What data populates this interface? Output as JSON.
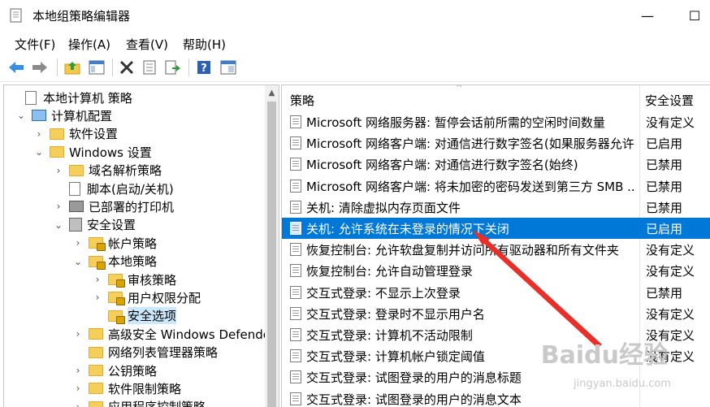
{
  "window": {
    "title": "本地组策略编辑器",
    "minimize": "—",
    "maximize": "☐"
  },
  "menu": [
    "文件(F)",
    "操作(A)",
    "查看(V)",
    "帮助(H)"
  ],
  "toolbar_icons": [
    "back-icon",
    "forward-icon",
    "up-folder-icon",
    "show-hide-tree-icon",
    "delete-icon",
    "properties-icon",
    "export-icon",
    "help-icon",
    "filter-icon"
  ],
  "tree": [
    {
      "label": "本地计算机 策略",
      "expand": "",
      "icon": "doc"
    },
    {
      "label": "计算机配置",
      "expand": "v",
      "icon": "pc"
    },
    {
      "label": "软件设置",
      "expand": ">",
      "icon": "folder"
    },
    {
      "label": "Windows 设置",
      "expand": "v",
      "icon": "folder"
    },
    {
      "label": "域名解析策略",
      "expand": ">",
      "icon": "folder"
    },
    {
      "label": "脚本(启动/关机)",
      "expand": "",
      "icon": "doc"
    },
    {
      "label": "已部署的打印机",
      "expand": ">",
      "icon": "printer"
    },
    {
      "label": "安全设置",
      "expand": "v",
      "icon": "shield"
    },
    {
      "label": "帐户策略",
      "expand": ">",
      "icon": "lockfolder"
    },
    {
      "label": "本地策略",
      "expand": "v",
      "icon": "lockfolder"
    },
    {
      "label": "审核策略",
      "expand": ">",
      "icon": "lockfolder"
    },
    {
      "label": "用户权限分配",
      "expand": ">",
      "icon": "lockfolder"
    },
    {
      "label": "安全选项",
      "expand": "",
      "icon": "lockfolder",
      "selected": true
    },
    {
      "label": "高级安全 Windows Defende",
      "expand": ">",
      "icon": "folder"
    },
    {
      "label": "网络列表管理器策略",
      "expand": "",
      "icon": "folder"
    },
    {
      "label": "公钥策略",
      "expand": ">",
      "icon": "folder"
    },
    {
      "label": "软件限制策略",
      "expand": ">",
      "icon": "folder"
    },
    {
      "label": "应用程序控制策略",
      "expand": ">",
      "icon": "folder"
    }
  ],
  "list": {
    "col_policy": "策略",
    "col_setting": "安全设置",
    "sort_indicator": "^",
    "rows": [
      {
        "name": "Microsoft 网络服务器: 暂停会话前所需的空闲时间数量",
        "value": "没有定义"
      },
      {
        "name": "Microsoft 网络客户端: 对通信进行数字签名(如果服务器允许)",
        "value": "已启用"
      },
      {
        "name": "Microsoft 网络客户端: 对通信进行数字签名(始终)",
        "value": "已禁用"
      },
      {
        "name": "Microsoft 网络客户端: 将未加密的密码发送到第三方 SMB ...",
        "value": "已禁用"
      },
      {
        "name": "关机: 清除虚拟内存页面文件",
        "value": "已禁用"
      },
      {
        "name": "关机: 允许系统在未登录的情况下关闭",
        "value": "已启用",
        "selected": true
      },
      {
        "name": "恢复控制台: 允许软盘复制并访问所有驱动器和所有文件夹",
        "value": "没有定义"
      },
      {
        "name": "恢复控制台: 允许自动管理登录",
        "value": "没有定义"
      },
      {
        "name": "交互式登录: 不显示上次登录",
        "value": "已禁用"
      },
      {
        "name": "交互式登录: 登录时不显示用户名",
        "value": "没有定义"
      },
      {
        "name": "交互式登录: 计算机不活动限制",
        "value": "没有定义"
      },
      {
        "name": "交互式登录: 计算机帐户锁定阈值",
        "value": "没有定义"
      },
      {
        "name": "交互式登录: 试图登录的用户的消息标题",
        "value": ""
      },
      {
        "name": "交互式登录: 试图登录的用户的消息文本",
        "value": ""
      }
    ]
  },
  "watermark": {
    "brand": "Baidu经验",
    "url": "jingyan.baidu.com"
  },
  "colors": {
    "selection": "#0078d7",
    "annotation_arrow": "#e8302a",
    "tree_selection": "#cce8ff"
  }
}
